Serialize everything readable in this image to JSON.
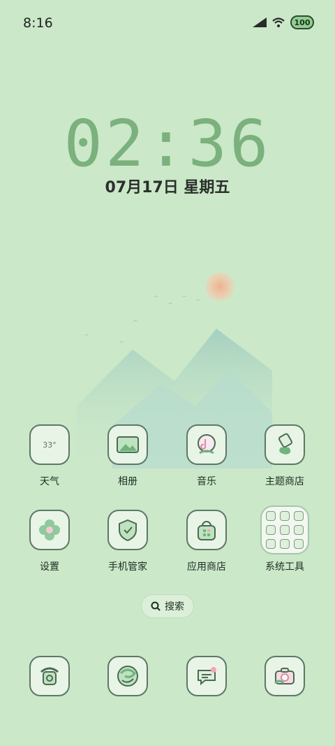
{
  "status": {
    "time": "8:16",
    "battery": "100"
  },
  "lockscreen": {
    "clock": "02:36",
    "date": "07月17日 星期五"
  },
  "apps": [
    {
      "name": "天气",
      "icon": "weather-icon",
      "extra": "33°"
    },
    {
      "name": "相册",
      "icon": "gallery-icon"
    },
    {
      "name": "音乐",
      "icon": "music-icon"
    },
    {
      "name": "主题商店",
      "icon": "theme-store-icon"
    },
    {
      "name": "设置",
      "icon": "settings-icon"
    },
    {
      "name": "手机管家",
      "icon": "phone-manager-icon"
    },
    {
      "name": "应用商店",
      "icon": "app-store-icon"
    },
    {
      "name": "系统工具",
      "icon": "system-tools-folder-icon"
    }
  ],
  "search": {
    "label": "搜索"
  },
  "dock": [
    {
      "icon": "phone-icon"
    },
    {
      "icon": "browser-icon"
    },
    {
      "icon": "messages-icon"
    },
    {
      "icon": "camera-icon"
    }
  ]
}
